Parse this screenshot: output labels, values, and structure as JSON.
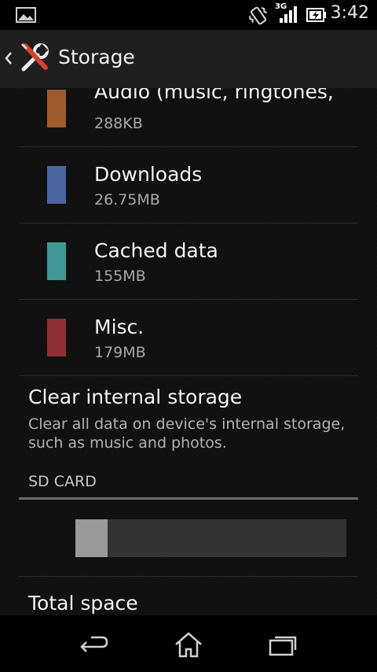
{
  "status_bar": {
    "time": "3:42",
    "network_label": "3G",
    "icons": [
      "gallery-icon",
      "vibrate-icon",
      "signal-icon",
      "battery-charging-icon"
    ]
  },
  "action_bar": {
    "title": "Storage",
    "icons": [
      "back-chevron-icon",
      "settings-tools-icon"
    ]
  },
  "storage_items": [
    {
      "label": "Audio (music, ringtones, etc.)",
      "value": "288KB",
      "color": "#a05a2c"
    },
    {
      "label": "Downloads",
      "value": "26.75MB",
      "color": "#4a64a0"
    },
    {
      "label": "Cached data",
      "value": "155MB",
      "color": "#3f9995"
    },
    {
      "label": "Misc.",
      "value": "179MB",
      "color": "#8f2f32"
    }
  ],
  "clear_storage": {
    "title": "Clear internal storage",
    "description": "Clear all data on device's internal storage, such as music and photos."
  },
  "sd_card": {
    "section_header": "SD CARD",
    "used_fraction": 0.12,
    "total_space_label": "Total space"
  },
  "nav_bar": {
    "icons": [
      "back-icon",
      "home-icon",
      "recent-apps-icon"
    ]
  }
}
